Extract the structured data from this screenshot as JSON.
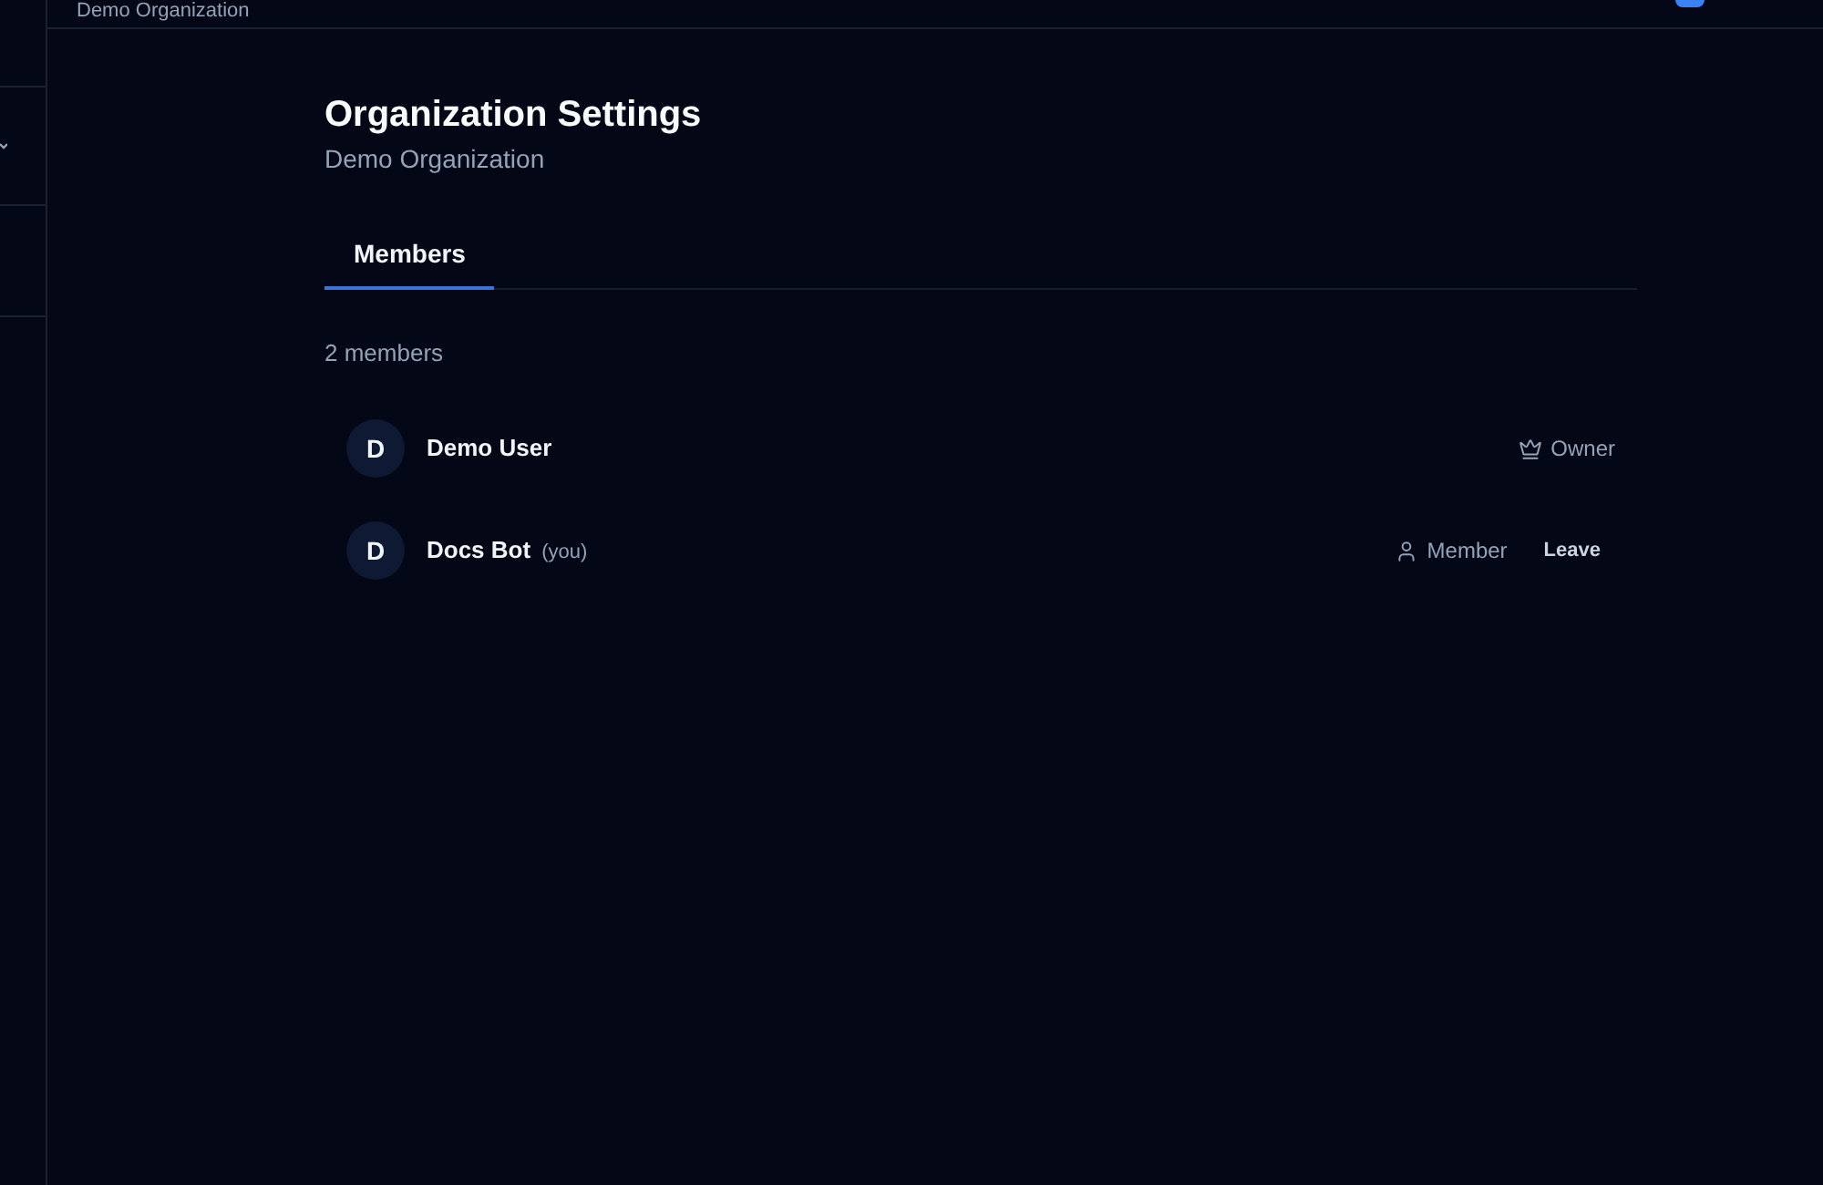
{
  "header": {
    "organization": "Demo Organization"
  },
  "page": {
    "title": "Organization Settings",
    "subtitle": "Demo Organization"
  },
  "tabs": [
    {
      "label": "Members",
      "selected": true
    }
  ],
  "member_count": "2 members",
  "members": [
    {
      "initial": "D",
      "name": "Demo User",
      "role": "Owner",
      "kind": "owner"
    },
    {
      "initial": "D",
      "name": "Docs Bot",
      "note": "(you)",
      "role": "Member",
      "kind": "member",
      "action": "Leave"
    }
  ]
}
